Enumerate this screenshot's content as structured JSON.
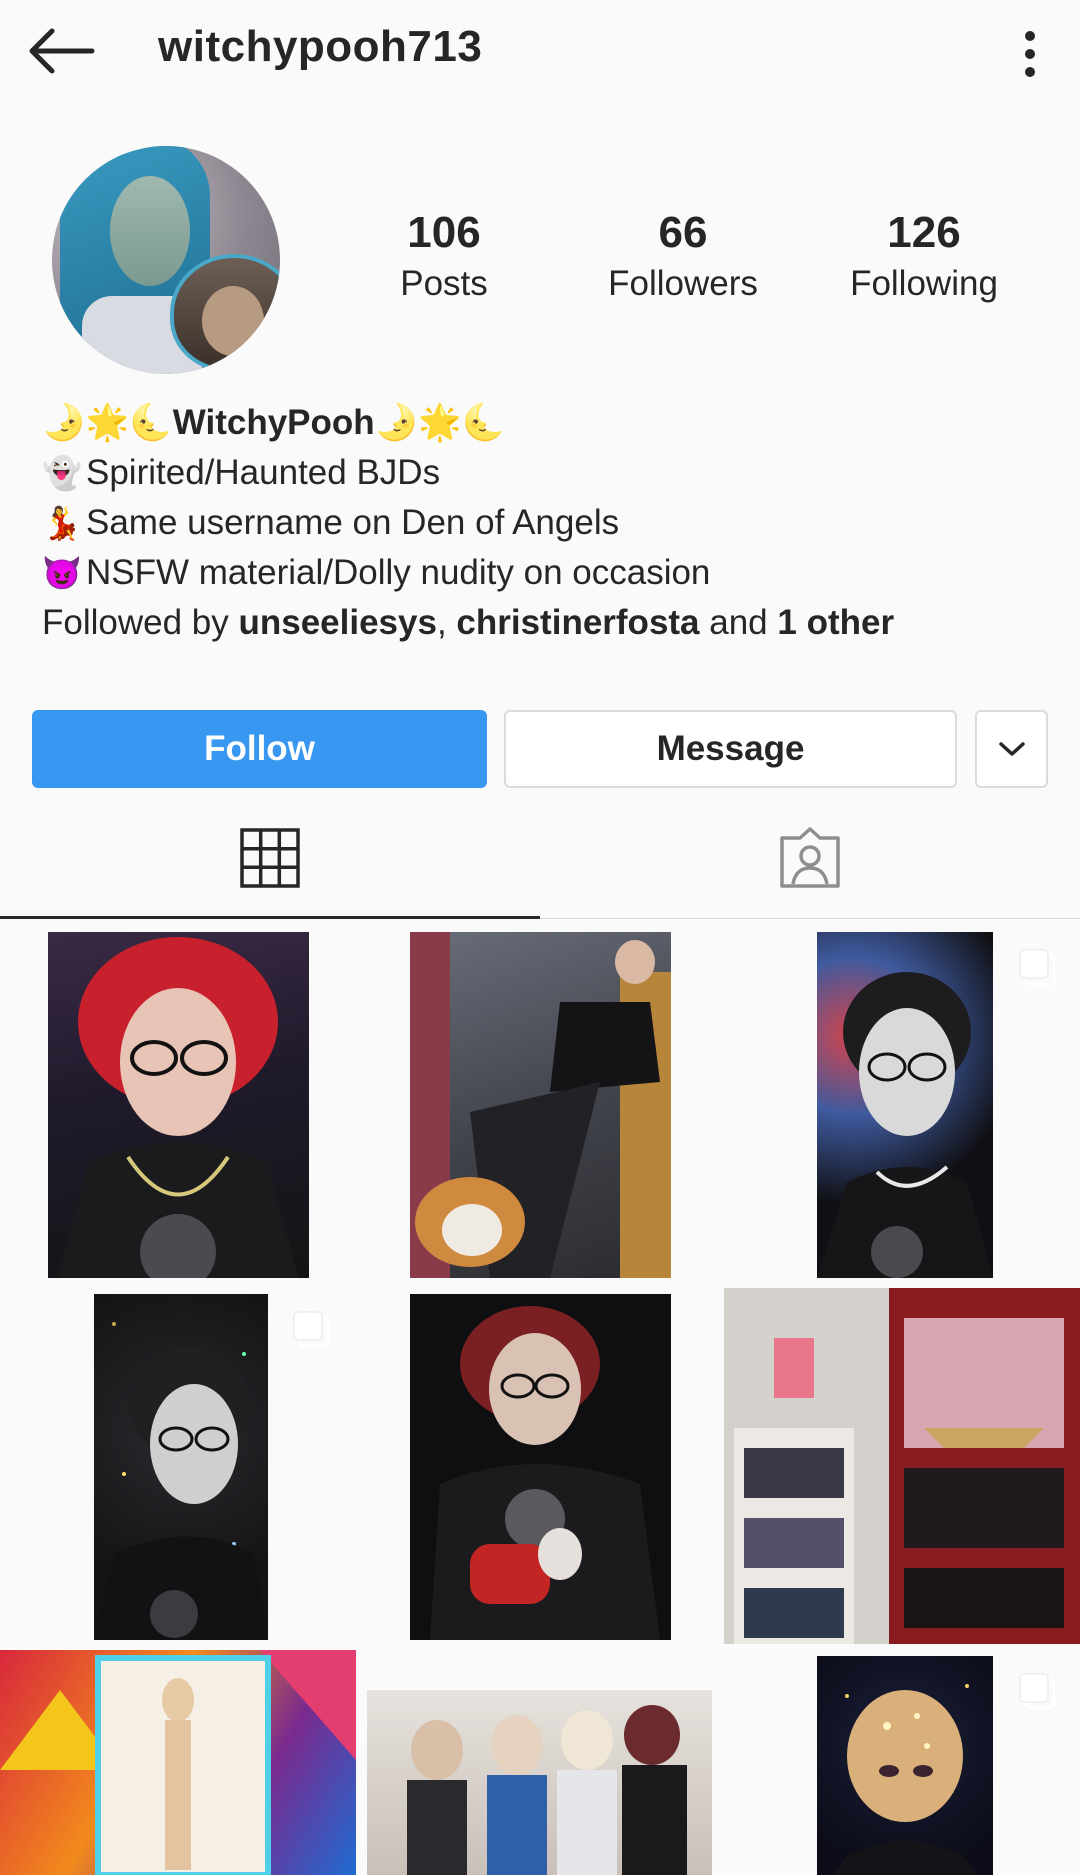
{
  "header": {
    "username": "witchypooh713",
    "back_icon": "arrow-left-icon",
    "more_icon": "more-vertical-icon"
  },
  "profile": {
    "avatar_icon": "profile-avatar",
    "stats": [
      {
        "value": "106",
        "label": "Posts"
      },
      {
        "value": "66",
        "label": "Followers"
      },
      {
        "value": "126",
        "label": "Following"
      }
    ]
  },
  "bio": {
    "name_prefix": "🌛🌟🌜",
    "name": "WitchyPooh",
    "name_suffix": "🌛🌟🌜",
    "lines": [
      {
        "emoji": "👻",
        "text": "Spirited/Haunted BJDs"
      },
      {
        "emoji": "💃",
        "text": "Same username on Den of Angels"
      },
      {
        "emoji": "😈",
        "text": "NSFW material/Dolly nudity on occasion"
      }
    ],
    "followed_by_prefix": "Followed by ",
    "followed_user1": "unseeliesys",
    "followed_sep": ", ",
    "followed_user2": "christinerfosta",
    "followed_and": " and ",
    "followed_other": "1 other"
  },
  "actions": {
    "follow": "Follow",
    "message": "Message",
    "dropdown_icon": "chevron-down-icon"
  },
  "tabs": {
    "grid_icon": "grid-icon",
    "tagged_icon": "tagged-person-icon",
    "active": "grid"
  },
  "colors": {
    "follow_blue": "#3897f0",
    "text": "#262626",
    "border": "#dbdbdb",
    "background": "#fafafa"
  },
  "posts": [
    {
      "name": "post-red-hair-doll",
      "multi": false
    },
    {
      "name": "post-doll-with-cat",
      "multi": false
    },
    {
      "name": "post-doll-glasses-bw",
      "multi": true
    },
    {
      "name": "post-doll-dark-sparkle",
      "multi": true
    },
    {
      "name": "post-doll-skull-shirt",
      "multi": false
    },
    {
      "name": "post-doll-shelf-room",
      "multi": false
    },
    {
      "name": "post-doll-colorful-note",
      "multi": false
    },
    {
      "name": "post-dolls-group",
      "multi": false
    },
    {
      "name": "post-doll-bald-stars",
      "multi": true
    }
  ]
}
